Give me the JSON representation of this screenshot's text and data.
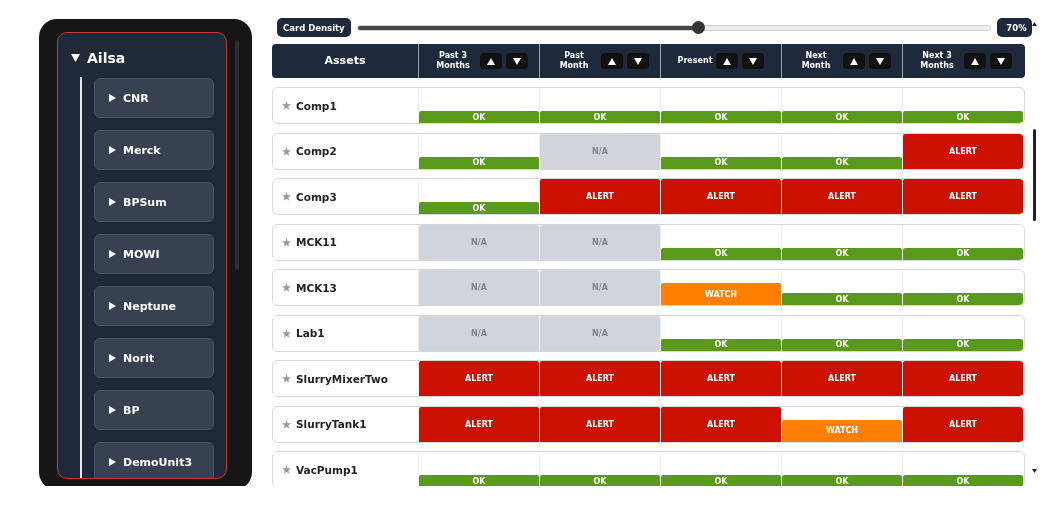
{
  "sidebar": {
    "root": {
      "label": "Ailsa",
      "expanded": true,
      "children": [
        {
          "label": "CNR",
          "expanded": false
        },
        {
          "label": "Merck",
          "expanded": false
        },
        {
          "label": "BPSum",
          "expanded": false
        },
        {
          "label": "MOWI",
          "expanded": false
        },
        {
          "label": "Neptune",
          "expanded": false
        },
        {
          "label": "Norit",
          "expanded": false
        },
        {
          "label": "BP",
          "expanded": false
        },
        {
          "label": "DemoUnit3",
          "expanded": false
        }
      ]
    }
  },
  "density": {
    "button": "Card Density",
    "level": 0.54,
    "reading": "70%"
  },
  "table": {
    "columns": [
      "Assets",
      "Past 3 Months",
      "Past Month",
      "Present",
      "Next Month",
      "Next 3 Months"
    ],
    "rows": [
      {
        "name": "Comp1",
        "cells": [
          {
            "kind": "good",
            "label": "OK"
          },
          {
            "kind": "good",
            "label": "OK"
          },
          {
            "kind": "good",
            "label": "OK"
          },
          {
            "kind": "good",
            "label": "OK"
          },
          {
            "kind": "good",
            "label": "OK"
          }
        ]
      },
      {
        "name": "Comp2",
        "cells": [
          {
            "kind": "good",
            "label": "OK"
          },
          {
            "kind": "none",
            "label": "N/A"
          },
          {
            "kind": "good",
            "label": "OK"
          },
          {
            "kind": "good",
            "label": "OK"
          },
          {
            "kind": "critical",
            "label": "ALERT"
          }
        ]
      },
      {
        "name": "Comp3",
        "cells": [
          {
            "kind": "good",
            "label": "OK"
          },
          {
            "kind": "critical",
            "label": "ALERT"
          },
          {
            "kind": "critical",
            "label": "ALERT"
          },
          {
            "kind": "critical",
            "label": "ALERT"
          },
          {
            "kind": "critical",
            "label": "ALERT"
          }
        ]
      },
      {
        "name": "MCK11",
        "cells": [
          {
            "kind": "none",
            "label": "N/A"
          },
          {
            "kind": "none",
            "label": "N/A"
          },
          {
            "kind": "good",
            "label": "OK"
          },
          {
            "kind": "good",
            "label": "OK"
          },
          {
            "kind": "good",
            "label": "OK"
          }
        ]
      },
      {
        "name": "MCK13",
        "cells": [
          {
            "kind": "none",
            "label": "N/A"
          },
          {
            "kind": "none",
            "label": "N/A"
          },
          {
            "kind": "caution",
            "label": "WATCH"
          },
          {
            "kind": "good",
            "label": "OK"
          },
          {
            "kind": "good",
            "label": "OK"
          }
        ]
      },
      {
        "name": "Lab1",
        "cells": [
          {
            "kind": "none",
            "label": "N/A"
          },
          {
            "kind": "none",
            "label": "N/A"
          },
          {
            "kind": "good",
            "label": "OK"
          },
          {
            "kind": "good",
            "label": "OK"
          },
          {
            "kind": "good",
            "label": "OK"
          }
        ]
      },
      {
        "name": "SlurryMixerTwo",
        "cells": [
          {
            "kind": "critical",
            "label": "ALERT"
          },
          {
            "kind": "critical",
            "label": "ALERT"
          },
          {
            "kind": "critical",
            "label": "ALERT"
          },
          {
            "kind": "critical",
            "label": "ALERT"
          },
          {
            "kind": "critical",
            "label": "ALERT"
          }
        ]
      },
      {
        "name": "SlurryTank1",
        "cells": [
          {
            "kind": "critical",
            "label": "ALERT"
          },
          {
            "kind": "critical",
            "label": "ALERT"
          },
          {
            "kind": "critical",
            "label": "ALERT"
          },
          {
            "kind": "caution",
            "label": "WATCH"
          },
          {
            "kind": "critical",
            "label": "ALERT"
          }
        ]
      },
      {
        "name": "VacPump1",
        "cells": [
          {
            "kind": "good",
            "label": "OK"
          },
          {
            "kind": "good",
            "label": "OK"
          },
          {
            "kind": "good",
            "label": "OK"
          },
          {
            "kind": "good",
            "label": "OK"
          },
          {
            "kind": "good",
            "label": "OK"
          }
        ]
      }
    ]
  }
}
